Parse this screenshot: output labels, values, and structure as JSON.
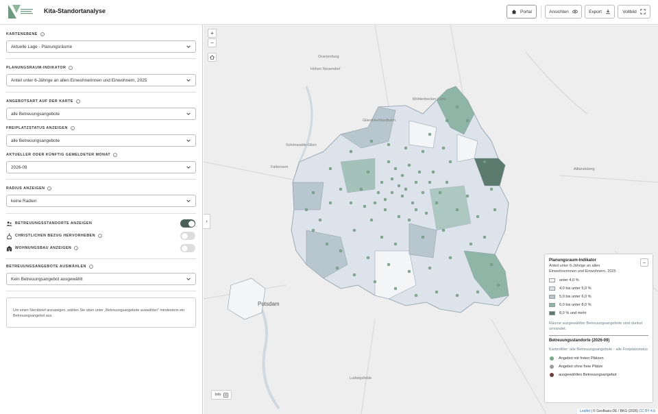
{
  "header": {
    "title": "Kita-Standortanalyse",
    "portal_label": "Portal",
    "ansichten_label": "Ansichten",
    "export_label": "Export",
    "vollbild_label": "Vollbild"
  },
  "sidebar": {
    "kartenebene": {
      "label": "Kartenebene",
      "value": "Aktuelle Lage - Planungsräume"
    },
    "indikator": {
      "label": "Planungsraum-Indikator",
      "value": "Anteil unter 6-Jährige an allen Einwohnerinnen und Einwohnern, 2025"
    },
    "angebotsart": {
      "label": "Angebotsart auf der Karte",
      "value": "alle Betreuungsangebote"
    },
    "freiplatz": {
      "label": "Freiplatzstatus anzeigen",
      "value": "alle Betreuungsangebote"
    },
    "monat": {
      "label": "Aktueller oder künftig gemeldeter Monat",
      "value": "2026-09"
    },
    "radius": {
      "label": "Radius anzeigen",
      "value": "keine Radien"
    },
    "toggles": [
      {
        "label": "Betreuungsstandorte anzeigen",
        "on": true
      },
      {
        "label": "Christlichen Bezug hervorheben",
        "on": false
      },
      {
        "label": "Wohnungsbau anzeigen",
        "on": false
      }
    ],
    "auswahl": {
      "label": "Betreuungsangebote auswählen",
      "value": "Kein Betreuungsangebot ausgewählt"
    },
    "hint": "Um einen Steckbrief anzuzeigen, wählen Sie oben unter „Betreuungsangebote auswählen\" mindestens ein Betreuungsangebot aus."
  },
  "map": {
    "places": {
      "oranienburg": "Oranienburg",
      "hohen_neuendorf": "Hohen Neuendorf",
      "muehlenbecker": "Mühlenbecker Land",
      "glienicke": "Glienicke/Nordbahn",
      "schoenwalde": "Schönwalde-Glien",
      "falkensee": "Falkensee",
      "altlandsberg": "Altlandsberg",
      "potsdam": "Potsdam",
      "ludwigsfelde": "Ludwigsfelde"
    },
    "info_label": "Info",
    "attribution_link": "Leaflet",
    "attribution_rest": " | © GeoBasis-DE / BKG (2026) ",
    "attribution_license": "CC BY 4.0"
  },
  "legend": {
    "title": "Planungsraum-Indikator",
    "subtitle": "Anteil unter 6-Jährige an allen Einwohnerinnen und Einwohnern, 2025",
    "classes": [
      {
        "label": "unter 4,0 %",
        "color": "#f3f5f7"
      },
      {
        "label": "4,0 bis unter 5,0 %",
        "color": "#dce3ea"
      },
      {
        "label": "5,0 bis unter 6,0 %",
        "color": "#b8c6cf"
      },
      {
        "label": "6,0 bis unter 8,0 %",
        "color": "#8fb5a6"
      },
      {
        "label": "8,0 % und mehr",
        "color": "#5d7a6f"
      }
    ],
    "note": "Räume ausgewählter Betreuungsangebote sind dunkel umrandet.",
    "standorte_title": "Betreuungsstandorte (2026-09)",
    "filter_note": "Kartenfilter: alle Betreuungsangebote - alle Freiplatzstatus",
    "points": [
      {
        "label": "Angebot mit freien Plätzen",
        "color": "#7aa889"
      },
      {
        "label": "Angebot ohne freie Plätze",
        "color": "#9b9b9b"
      },
      {
        "label": "ausgewähltes Betreuungsangebot",
        "color": "#6b3a3a"
      }
    ]
  }
}
